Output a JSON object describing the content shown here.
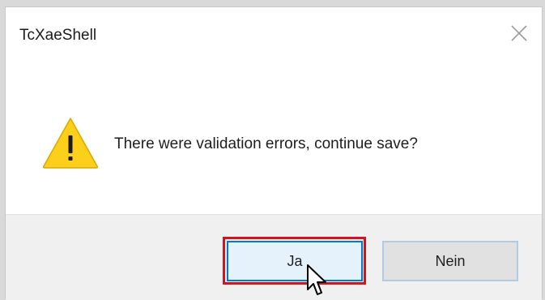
{
  "window": {
    "title": "TcXaeShell"
  },
  "message": {
    "text": "There were validation errors, continue save?",
    "icon": "warning-icon"
  },
  "buttons": {
    "yes_label": "Ja",
    "no_label": "Nein"
  },
  "colors": {
    "highlight": "#d4141c",
    "warning_fill": "#fccf1b",
    "focus_border": "#0078d7"
  }
}
